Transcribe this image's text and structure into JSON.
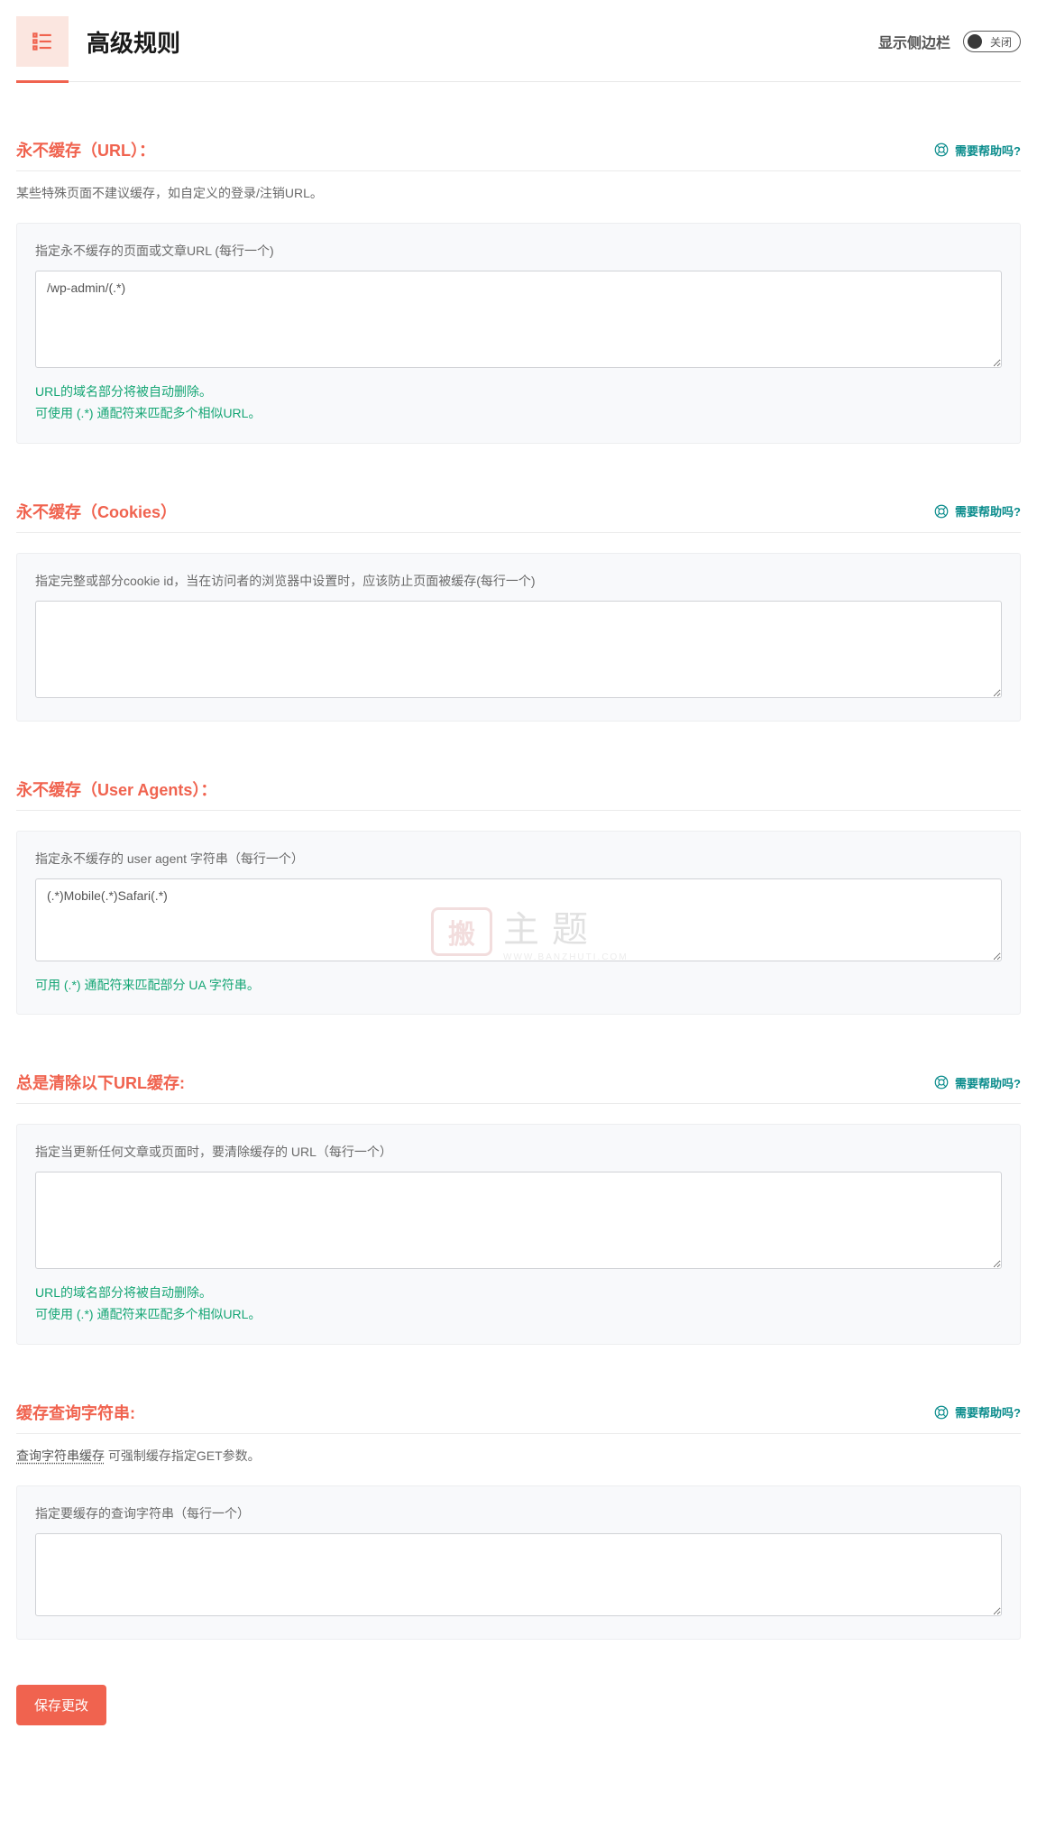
{
  "header": {
    "title": "高级规则",
    "sidebar_label": "显示侧边栏",
    "toggle_label": "关闭"
  },
  "help_label": "需要帮助吗?",
  "sections": {
    "never_cache_url": {
      "title": "永不缓存（URL）：",
      "desc": "某些特殊页面不建议缓存，如自定义的登录/注销URL。",
      "field_label": "指定永不缓存的页面或文章URL (每行一个)",
      "value": "/wp-admin/(.*)",
      "hint1": "URL的域名部分将被自动删除。",
      "hint2": "可使用 (.*) 通配符来匹配多个相似URL。"
    },
    "never_cache_cookies": {
      "title": "永不缓存（Cookies）",
      "field_label": "指定完整或部分cookie id，当在访问者的浏览器中设置时，应该防止页面被缓存(每行一个)",
      "value": ""
    },
    "never_cache_ua": {
      "title": "永不缓存（User Agents）：",
      "field_label": "指定永不缓存的 user agent 字符串（每行一个）",
      "value": "(.*)Mobile(.*)Safari(.*)",
      "hint1": "可用 (.*) 通配符来匹配部分 UA 字符串。"
    },
    "always_purge": {
      "title": "总是清除以下URL缓存:",
      "field_label": "指定当更新任何文章或页面时，要清除缓存的 URL（每行一个）",
      "value": "",
      "hint1": "URL的域名部分将被自动删除。",
      "hint2": "可使用 (.*) 通配符来匹配多个相似URL。"
    },
    "cache_query": {
      "title": "缓存查询字符串:",
      "desc_link": "查询字符串缓存",
      "desc_rest": " 可强制缓存指定GET参数。",
      "field_label": "指定要缓存的查询字符串（每行一个）",
      "value": ""
    }
  },
  "save_button": "保存更改",
  "watermark": {
    "stamp": "搬",
    "cn": "主题",
    "en": "WWW.BANZHUTI.COM"
  }
}
